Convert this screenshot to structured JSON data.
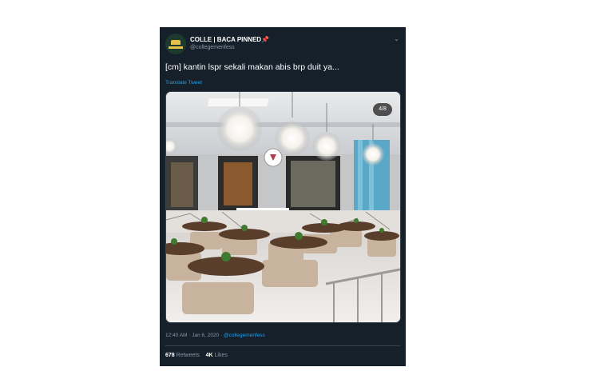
{
  "tweet": {
    "display_name": "COLLE | BACA PINNED",
    "pin_emoji": "📌",
    "handle": "@collegemenfess",
    "text": "[cm] kantin lspr sekali makan abis brp duit ya...",
    "translate_label": "Translate Tweet",
    "image_counter": "4/8",
    "time": "12:40 AM",
    "date": "Jan 6, 2020",
    "separator": "·",
    "via_handle": "@collegemenfess",
    "retweets_count": "678",
    "retweets_label": "Retweets",
    "likes_count": "4K",
    "likes_label": "Likes",
    "image_description_icon": "chevron-down-icon"
  },
  "colors": {
    "background": "#15202b",
    "accent": "#1da1f2",
    "muted": "#8899a6",
    "pin": "#e0245e"
  }
}
